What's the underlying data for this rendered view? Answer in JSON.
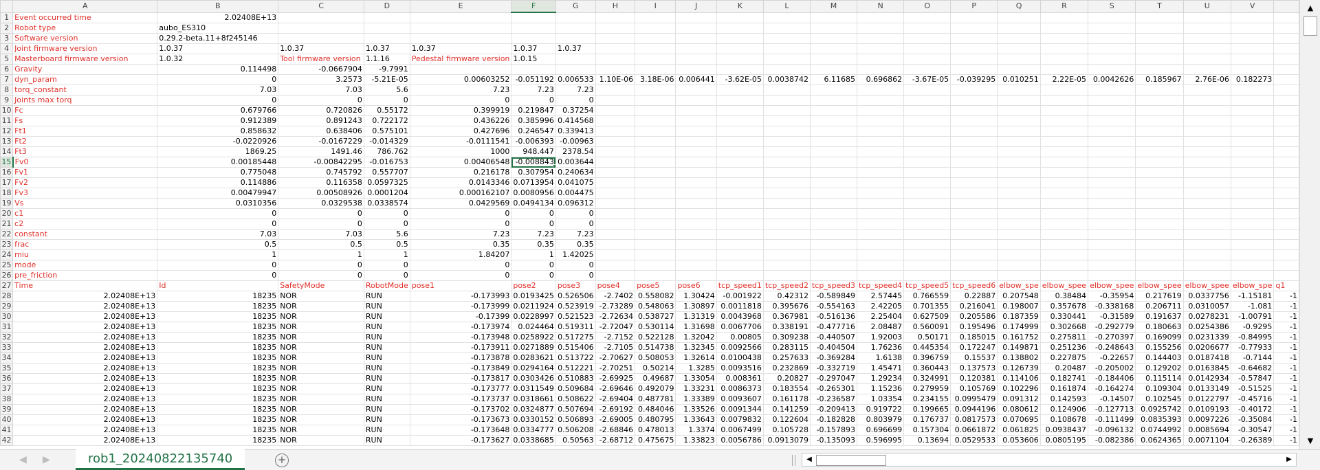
{
  "columns": [
    "A",
    "B",
    "C",
    "D",
    "E",
    "F",
    "G",
    "H",
    "I",
    "J",
    "K",
    "L",
    "M",
    "N",
    "O",
    "P",
    "Q",
    "R",
    "S",
    "T",
    "U",
    "V"
  ],
  "selected_column": "F",
  "selected_row": 15,
  "active_cell": "F15",
  "rows": [
    {
      "n": 1,
      "c": {
        "A": "Event occurred time",
        "B": "2.02408E+13"
      }
    },
    {
      "n": 2,
      "c": {
        "A": "Robot type",
        "B": "aubo_ES310"
      }
    },
    {
      "n": 3,
      "c": {
        "A": "Software version",
        "B": "0.29.2-beta.11+8f245146"
      }
    },
    {
      "n": 4,
      "c": {
        "A": "Joint firmware version",
        "B": "1.0.37",
        "C": "1.0.37",
        "D": "1.0.37",
        "E": "1.0.37",
        "F": "1.0.37",
        "G": "1.0.37"
      }
    },
    {
      "n": 5,
      "c": {
        "A": "Masterboard firmware version",
        "B": "1.0.32",
        "C": "Tool firmware version",
        "D": "1.1.16",
        "E": "Pedestal firmware version",
        "F": "1.0.15"
      }
    },
    {
      "n": 6,
      "c": {
        "A": "Gravity",
        "B": "0.114498",
        "C": "-0.0667904",
        "D": "-9.7991"
      }
    },
    {
      "n": 7,
      "c": {
        "A": "dyn_param",
        "B": "0",
        "C": "3.2573",
        "D": "-5.21E-05",
        "E": "0.00603252",
        "F": "-0.051192",
        "G": "0.006533",
        "H": "1.10E-06",
        "I": "3.18E-06",
        "J": "0.006441",
        "K": "-3.62E-05",
        "L": "0.0038742",
        "M": "6.11685",
        "N": "0.696862",
        "O": "-3.67E-05",
        "P": "-0.039295",
        "Q": "0.010251",
        "R": "2.22E-05",
        "S": "0.0042626",
        "T": "0.185967",
        "U": "2.76E-06",
        "V": "0.182273"
      }
    },
    {
      "n": 8,
      "c": {
        "A": "torq_constant",
        "B": "7.03",
        "C": "7.03",
        "D": "5.6",
        "E": "7.23",
        "F": "7.23",
        "G": "7.23"
      }
    },
    {
      "n": 9,
      "c": {
        "A": "Joints max torq",
        "B": "0",
        "C": "0",
        "D": "0",
        "E": "0",
        "F": "0",
        "G": "0"
      }
    },
    {
      "n": 10,
      "c": {
        "A": "Fc",
        "B": "0.679766",
        "C": "0.720826",
        "D": "0.55172",
        "E": "0.399919",
        "F": "0.219847",
        "G": "0.37254"
      }
    },
    {
      "n": 11,
      "c": {
        "A": "Fs",
        "B": "0.912389",
        "C": "0.891243",
        "D": "0.722172",
        "E": "0.436226",
        "F": "0.385996",
        "G": "0.414568"
      }
    },
    {
      "n": 12,
      "c": {
        "A": "Ft1",
        "B": "0.858632",
        "C": "0.638406",
        "D": "0.575101",
        "E": "0.427696",
        "F": "0.246547",
        "G": "0.339413"
      }
    },
    {
      "n": 13,
      "c": {
        "A": "Ft2",
        "B": "-0.0220926",
        "C": "-0.0167229",
        "D": "-0.014329",
        "E": "-0.0111541",
        "F": "-0.006393",
        "G": "-0.00963"
      }
    },
    {
      "n": 14,
      "c": {
        "A": "Ft3",
        "B": "1869.25",
        "C": "1491.46",
        "D": "786.762",
        "E": "1000",
        "F": "948.447",
        "G": "2378.54"
      }
    },
    {
      "n": 15,
      "c": {
        "A": "Fv0",
        "B": "0.00185448",
        "C": "-0.00842295",
        "D": "-0.016753",
        "E": "0.00406548",
        "F": "-0.008843",
        "G": "0.003644"
      }
    },
    {
      "n": 16,
      "c": {
        "A": "Fv1",
        "B": "0.775048",
        "C": "0.745792",
        "D": "0.557707",
        "E": "0.216178",
        "F": "0.307954",
        "G": "0.240634"
      }
    },
    {
      "n": 17,
      "c": {
        "A": "Fv2",
        "B": "0.114886",
        "C": "0.116358",
        "D": "0.0597325",
        "E": "0.0143346",
        "F": "0.0713954",
        "G": "0.041075"
      }
    },
    {
      "n": 18,
      "c": {
        "A": "Fv3",
        "B": "0.00479947",
        "C": "0.00508926",
        "D": "0.0001204",
        "E": "0.000162107",
        "F": "0.0080956",
        "G": "0.004475"
      }
    },
    {
      "n": 19,
      "c": {
        "A": "Vs",
        "B": "0.0310356",
        "C": "0.0329538",
        "D": "0.0338574",
        "E": "0.0429569",
        "F": "0.0494134",
        "G": "0.096312"
      }
    },
    {
      "n": 20,
      "c": {
        "A": "c1",
        "B": "0",
        "C": "0",
        "D": "0",
        "E": "0",
        "F": "0",
        "G": "0"
      }
    },
    {
      "n": 21,
      "c": {
        "A": "c2",
        "B": "0",
        "C": "0",
        "D": "0",
        "E": "0",
        "F": "0",
        "G": "0"
      }
    },
    {
      "n": 22,
      "c": {
        "A": "constant",
        "B": "7.03",
        "C": "7.03",
        "D": "5.6",
        "E": "7.23",
        "F": "7.23",
        "G": "7.23"
      }
    },
    {
      "n": 23,
      "c": {
        "A": "frac",
        "B": "0.5",
        "C": "0.5",
        "D": "0.5",
        "E": "0.35",
        "F": "0.35",
        "G": "0.35"
      }
    },
    {
      "n": 24,
      "c": {
        "A": "miu",
        "B": "1",
        "C": "1",
        "D": "1",
        "E": "1.84207",
        "F": "1",
        "G": "1.42025"
      }
    },
    {
      "n": 25,
      "c": {
        "A": "mode",
        "B": "0",
        "C": "0",
        "D": "0",
        "E": "0",
        "F": "0",
        "G": "0"
      }
    },
    {
      "n": 26,
      "c": {
        "A": "pre_friction",
        "B": "0",
        "C": "0",
        "D": "0",
        "E": "0",
        "F": "0",
        "G": "0"
      }
    },
    {
      "n": 27,
      "c": {
        "A": "Time",
        "B": "Id",
        "C": "SafetyMode",
        "D": "RobotMode",
        "E": "pose1",
        "F": "pose2",
        "G": "pose3",
        "H": "pose4",
        "I": "pose5",
        "J": "pose6",
        "K": "tcp_speed1",
        "L": "tcp_speed2",
        "M": "tcp_speed3",
        "N": "tcp_speed4",
        "O": "tcp_speed5",
        "P": "tcp_speed6",
        "Q": "elbow_spe",
        "R": "elbow_spee",
        "S": "elbow_spee",
        "T": "elbow_spee",
        "U": "elbow_spee",
        "V": "elbow_spe",
        "W": "q1"
      }
    },
    {
      "n": 28,
      "c": {
        "A": "2.02408E+13",
        "B": "18235",
        "C": "NOR",
        "D": "RUN",
        "E": "-0.173993",
        "F": "0.0193425",
        "G": "0.526506",
        "H": "-2.7402",
        "I": "0.558082",
        "J": "1.30424",
        "K": "-0.001922",
        "L": "0.42312",
        "M": "-0.589849",
        "N": "2.57445",
        "O": "0.766559",
        "P": "0.22887",
        "Q": "0.207548",
        "R": "0.38484",
        "S": "-0.35954",
        "T": "0.217619",
        "U": "0.0337756",
        "V": "-1.15181",
        "W": "-1"
      }
    },
    {
      "n": 29,
      "c": {
        "A": "2.02408E+13",
        "B": "18235",
        "C": "NOR",
        "D": "RUN",
        "E": "-0.173999",
        "F": "0.0211924",
        "G": "0.523919",
        "H": "-2.73289",
        "I": "0.548063",
        "J": "1.30897",
        "K": "0.0011818",
        "L": "0.395676",
        "M": "-0.554163",
        "N": "2.42205",
        "O": "0.701355",
        "P": "0.216041",
        "Q": "0.198007",
        "R": "0.357678",
        "S": "-0.338168",
        "T": "0.206711",
        "U": "0.0310057",
        "V": "-1.081",
        "W": "-1"
      }
    },
    {
      "n": 30,
      "c": {
        "A": "2.02408E+13",
        "B": "18235",
        "C": "NOR",
        "D": "RUN",
        "E": "-0.17399",
        "F": "0.0228997",
        "G": "0.521523",
        "H": "-2.72634",
        "I": "0.538727",
        "J": "1.31319",
        "K": "0.0043968",
        "L": "0.367981",
        "M": "-0.516136",
        "N": "2.25404",
        "O": "0.627509",
        "P": "0.205586",
        "Q": "0.187359",
        "R": "0.330441",
        "S": "-0.31589",
        "T": "0.191637",
        "U": "0.0278231",
        "V": "-1.00791",
        "W": "-1"
      }
    },
    {
      "n": 31,
      "c": {
        "A": "2.02408E+13",
        "B": "18235",
        "C": "NOR",
        "D": "RUN",
        "E": "-0.173974",
        "F": "0.024464",
        "G": "0.519311",
        "H": "-2.72047",
        "I": "0.530114",
        "J": "1.31698",
        "K": "0.0067706",
        "L": "0.338191",
        "M": "-0.477716",
        "N": "2.08487",
        "O": "0.560091",
        "P": "0.195496",
        "Q": "0.174999",
        "R": "0.302668",
        "S": "-0.292779",
        "T": "0.180663",
        "U": "0.0254386",
        "V": "-0.9295",
        "W": "-1"
      }
    },
    {
      "n": 32,
      "c": {
        "A": "2.02408E+13",
        "B": "18235",
        "C": "NOR",
        "D": "RUN",
        "E": "-0.173948",
        "F": "0.0258922",
        "G": "0.517275",
        "H": "-2.7152",
        "I": "0.522128",
        "J": "1.32042",
        "K": "0.00805",
        "L": "0.309238",
        "M": "-0.440507",
        "N": "1.92003",
        "O": "0.50171",
        "P": "0.185015",
        "Q": "0.161752",
        "R": "0.275811",
        "S": "-0.270397",
        "T": "0.169099",
        "U": "0.0231339",
        "V": "-0.84995",
        "W": "-1"
      }
    },
    {
      "n": 33,
      "c": {
        "A": "2.02408E+13",
        "B": "18235",
        "C": "NOR",
        "D": "RUN",
        "E": "-0.173911",
        "F": "0.0271889",
        "G": "0.515406",
        "H": "-2.7105",
        "I": "0.514738",
        "J": "1.32345",
        "K": "0.0092566",
        "L": "0.283115",
        "M": "-0.404504",
        "N": "1.76236",
        "O": "0.445354",
        "P": "0.172247",
        "Q": "0.149871",
        "R": "0.251236",
        "S": "-0.248643",
        "T": "0.155256",
        "U": "0.0206677",
        "V": "-0.77933",
        "W": "-1"
      }
    },
    {
      "n": 34,
      "c": {
        "A": "2.02408E+13",
        "B": "18235",
        "C": "NOR",
        "D": "RUN",
        "E": "-0.173878",
        "F": "0.0283621",
        "G": "0.513722",
        "H": "-2.70627",
        "I": "0.508053",
        "J": "1.32614",
        "K": "0.0100438",
        "L": "0.257633",
        "M": "-0.369284",
        "N": "1.6138",
        "O": "0.396759",
        "P": "0.15537",
        "Q": "0.138802",
        "R": "0.227875",
        "S": "-0.22657",
        "T": "0.144403",
        "U": "0.0187418",
        "V": "-0.7144",
        "W": "-1"
      }
    },
    {
      "n": 35,
      "c": {
        "A": "2.02408E+13",
        "B": "18235",
        "C": "NOR",
        "D": "RUN",
        "E": "-0.173849",
        "F": "0.0294164",
        "G": "0.512221",
        "H": "-2.70251",
        "I": "0.50214",
        "J": "1.3285",
        "K": "0.0093516",
        "L": "0.232869",
        "M": "-0.332719",
        "N": "1.45471",
        "O": "0.360443",
        "P": "0.137573",
        "Q": "0.126739",
        "R": "0.20487",
        "S": "-0.205002",
        "T": "0.129202",
        "U": "0.0163845",
        "V": "-0.64682",
        "W": "-1"
      }
    },
    {
      "n": 36,
      "c": {
        "A": "2.02408E+13",
        "B": "18235",
        "C": "NOR",
        "D": "RUN",
        "E": "-0.173817",
        "F": "0.0303426",
        "G": "0.510883",
        "H": "-2.69925",
        "I": "0.49687",
        "J": "1.33054",
        "K": "0.008361",
        "L": "0.20827",
        "M": "-0.297047",
        "N": "1.29234",
        "O": "0.324991",
        "P": "0.120381",
        "Q": "0.114106",
        "R": "0.182741",
        "S": "-0.184406",
        "T": "0.115114",
        "U": "0.0142934",
        "V": "-0.57847",
        "W": "-1"
      }
    },
    {
      "n": 37,
      "c": {
        "A": "2.02408E+13",
        "B": "18235",
        "C": "NOR",
        "D": "RUN",
        "E": "-0.173777",
        "F": "0.0311549",
        "G": "0.509684",
        "H": "-2.69646",
        "I": "0.492079",
        "J": "1.33231",
        "K": "0.0086373",
        "L": "0.183554",
        "M": "-0.265301",
        "N": "1.15236",
        "O": "0.279959",
        "P": "0.105769",
        "Q": "0.102296",
        "R": "0.161874",
        "S": "-0.164274",
        "T": "0.109304",
        "U": "0.0133149",
        "V": "-0.51525",
        "W": "-1"
      }
    },
    {
      "n": 38,
      "c": {
        "A": "2.02408E+13",
        "B": "18235",
        "C": "NOR",
        "D": "RUN",
        "E": "-0.173737",
        "F": "0.0318661",
        "G": "0.508622",
        "H": "-2.69404",
        "I": "0.487781",
        "J": "1.33389",
        "K": "0.0093607",
        "L": "0.161178",
        "M": "-0.236587",
        "N": "1.03354",
        "O": "0.234155",
        "P": "0.0995479",
        "Q": "0.091312",
        "R": "0.142593",
        "S": "-0.14507",
        "T": "0.102545",
        "U": "0.0122797",
        "V": "-0.45716",
        "W": "-1"
      }
    },
    {
      "n": 39,
      "c": {
        "A": "2.02408E+13",
        "B": "18235",
        "C": "NOR",
        "D": "RUN",
        "E": "-0.173702",
        "F": "0.0324877",
        "G": "0.507694",
        "H": "-2.69192",
        "I": "0.484046",
        "J": "1.33526",
        "K": "0.0091344",
        "L": "0.141259",
        "M": "-0.209413",
        "N": "0.919722",
        "O": "0.199665",
        "P": "0.0944196",
        "Q": "0.080612",
        "R": "0.124906",
        "S": "-0.127713",
        "T": "0.0925742",
        "U": "0.0109193",
        "V": "-0.40172",
        "W": "-1"
      }
    },
    {
      "n": 40,
      "c": {
        "A": "2.02408E+13",
        "B": "18235",
        "C": "NOR",
        "D": "RUN",
        "E": "-0.173673",
        "F": "0.0330152",
        "G": "0.506893",
        "H": "-2.69005",
        "I": "0.480795",
        "J": "1.33643",
        "K": "0.0079832",
        "L": "0.122604",
        "M": "-0.182828",
        "N": "0.803979",
        "O": "0.176737",
        "P": "0.0817573",
        "Q": "0.070695",
        "R": "0.108678",
        "S": "-0.111499",
        "T": "0.0835393",
        "U": "0.0097226",
        "V": "-0.35084",
        "W": "-1"
      }
    },
    {
      "n": 41,
      "c": {
        "A": "2.02408E+13",
        "B": "18235",
        "C": "NOR",
        "D": "RUN",
        "E": "-0.173648",
        "F": "0.0334777",
        "G": "0.506208",
        "H": "-2.68846",
        "I": "0.478013",
        "J": "1.3374",
        "K": "0.0067499",
        "L": "0.105728",
        "M": "-0.157893",
        "N": "0.696699",
        "O": "0.157304",
        "P": "0.0661872",
        "Q": "0.061825",
        "R": "0.0938437",
        "S": "-0.096132",
        "T": "0.0744992",
        "U": "0.0085694",
        "V": "-0.30547",
        "W": "-1"
      }
    },
    {
      "n": 42,
      "c": {
        "A": "2.02408E+13",
        "B": "18235",
        "C": "NOR",
        "D": "RUN",
        "E": "-0.173627",
        "F": "0.0338685",
        "G": "0.50563",
        "H": "-2.68712",
        "I": "0.475675",
        "J": "1.33823",
        "K": "0.0056786",
        "L": "0.0913079",
        "M": "-0.135093",
        "N": "0.596995",
        "O": "0.13694",
        "P": "0.0529533",
        "Q": "0.053606",
        "R": "0.0805195",
        "S": "-0.082386",
        "T": "0.0624365",
        "U": "0.0071104",
        "V": "-0.26389",
        "W": "-1"
      }
    }
  ],
  "sheet_tab": "rob1_20240822135740",
  "icons": {
    "prev_sheet": "◀",
    "next_sheet": "▶",
    "add_sheet": "+",
    "scroll_up": "▲",
    "scroll_down": "▼",
    "scroll_left": "◀",
    "scroll_right": "▶"
  }
}
